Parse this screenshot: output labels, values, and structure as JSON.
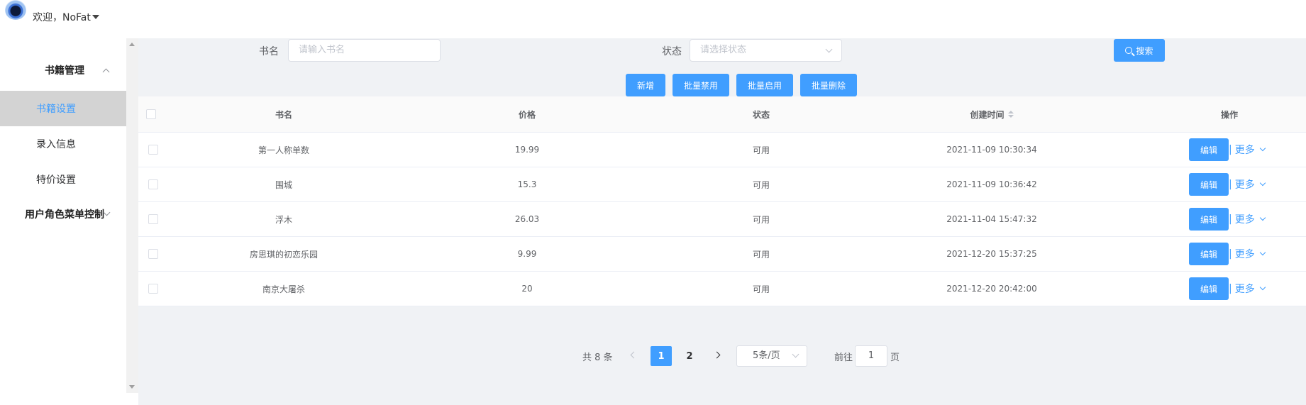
{
  "header": {
    "welcome": "欢迎，NoFat"
  },
  "sidebar": {
    "groups": [
      {
        "label": "书籍管理"
      },
      {
        "label": "用户角色菜单控制"
      }
    ],
    "items": [
      {
        "label": "书籍设置",
        "active": true
      },
      {
        "label": "录入信息"
      },
      {
        "label": "特价设置"
      }
    ]
  },
  "search": {
    "name_label": "书名",
    "name_placeholder": "请输入书名",
    "status_label": "状态",
    "status_placeholder": "请选择状态",
    "search_button": "搜索"
  },
  "toolbar": {
    "add": "新增",
    "batch_disable": "批量禁用",
    "batch_enable": "批量启用",
    "batch_delete": "批量删除"
  },
  "table": {
    "headers": [
      "书名",
      "价格",
      "状态",
      "创建时间",
      "操作"
    ],
    "rows": [
      {
        "name": "第一人称单数",
        "price": "19.99",
        "status": "可用",
        "created": "2021-11-09 10:30:34"
      },
      {
        "name": "围城",
        "price": "15.3",
        "status": "可用",
        "created": "2021-11-09 10:36:42"
      },
      {
        "name": "浮木",
        "price": "26.03",
        "status": "可用",
        "created": "2021-11-04 15:47:32"
      },
      {
        "name": "房思琪的初恋乐园",
        "price": "9.99",
        "status": "可用",
        "created": "2021-12-20 15:37:25"
      },
      {
        "name": "南京大屠杀",
        "price": "20",
        "status": "可用",
        "created": "2021-12-20 20:42:00"
      }
    ],
    "edit_label": "编辑",
    "more_label": "更多",
    "separator": "|"
  },
  "pagination": {
    "total": "共 8 条",
    "pages": [
      "1",
      "2"
    ],
    "current": "1",
    "page_size": "5条/页",
    "goto_label": "前往",
    "goto_value": "1",
    "page_suffix": "页"
  },
  "colors": {
    "primary": "#409eff",
    "active_bg": "#d3d3d3",
    "main_bg": "#f0f2f5"
  }
}
